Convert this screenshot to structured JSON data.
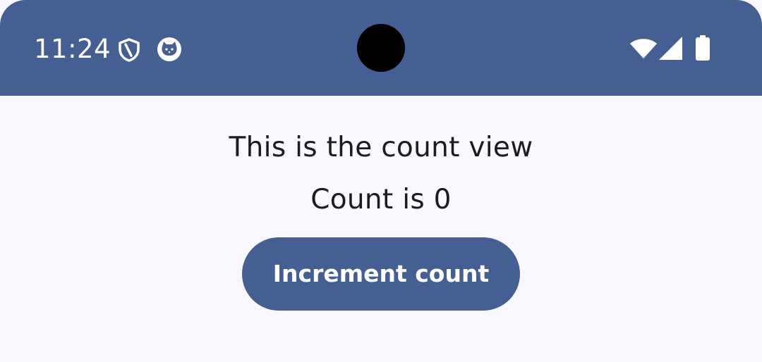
{
  "status_bar": {
    "time": "11:24",
    "background_color": "#455f92",
    "icons": [
      "shield-icon",
      "cat-icon",
      "wifi-icon",
      "signal-icon",
      "battery-icon"
    ]
  },
  "main": {
    "title": "This is the count view",
    "count_label": "Count is 0",
    "button_label": "Increment count",
    "background_color": "#f9f8fe",
    "button_color": "#455f92"
  }
}
